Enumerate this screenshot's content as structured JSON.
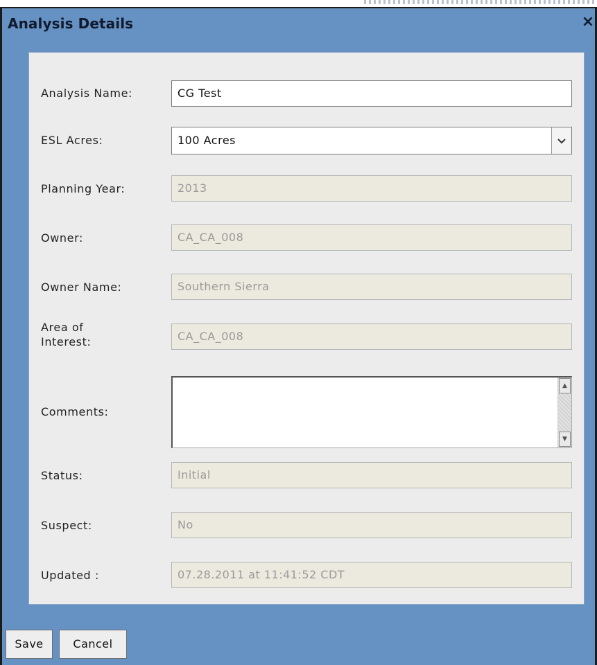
{
  "dialog": {
    "title": "Analysis Details",
    "close_symbol": "×"
  },
  "fields": {
    "analysis_name": {
      "label": "Analysis Name:",
      "value": "CG Test"
    },
    "esl_acres": {
      "label": "ESL Acres:",
      "value": "100 Acres",
      "arrow": "⌄"
    },
    "planning_year": {
      "label": "Planning Year:",
      "value": "2013"
    },
    "owner": {
      "label": "Owner:",
      "value": "CA_CA_008"
    },
    "owner_name": {
      "label": "Owner Name:",
      "value": "Southern Sierra"
    },
    "area_of_interest": {
      "label_line1": "Area of",
      "label_line2": "Interest:",
      "value": "CA_CA_008"
    },
    "comments": {
      "label": "Comments:",
      "value": ""
    },
    "status": {
      "label": "Status:",
      "value": "Initial"
    },
    "suspect": {
      "label": "Suspect:",
      "value": "No"
    },
    "updated": {
      "label": "Updated :",
      "value": "07.28.2011 at 11:41:52 CDT"
    }
  },
  "buttons": {
    "save": "Save",
    "cancel": "Cancel"
  },
  "icons": {
    "close": "close-icon",
    "dropdown": "chevron-down-icon",
    "scroll_up": "scroll-up-icon",
    "scroll_down": "scroll-down-icon"
  },
  "colors": {
    "dialog_background": "#6592c2",
    "panel_background": "#ececec",
    "readonly_field": "#ece9de"
  }
}
